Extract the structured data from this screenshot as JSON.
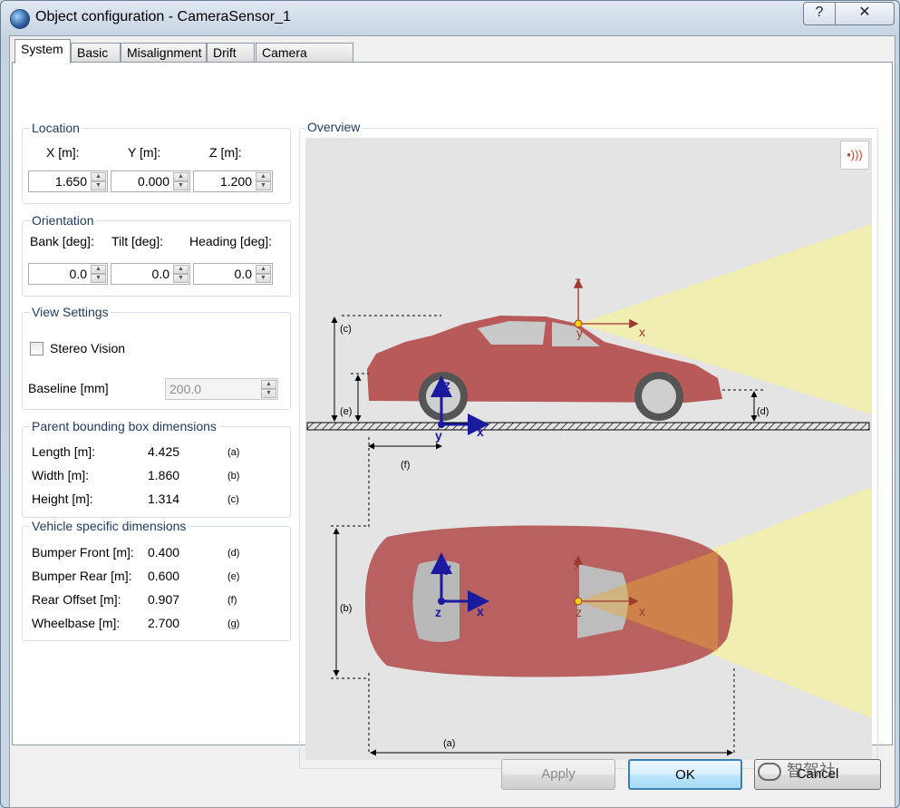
{
  "window": {
    "title": "Object configuration - CameraSensor_1",
    "help_glyph": "?",
    "close_glyph": "✕"
  },
  "tabs": [
    {
      "label": "System"
    },
    {
      "label": "Basic"
    },
    {
      "label": "Misalignment"
    },
    {
      "label": "Drift"
    },
    {
      "label": "Camera Effects"
    }
  ],
  "location": {
    "title": "Location",
    "x_label": "X  [m]:",
    "y_label": "Y [m]:",
    "z_label": "Z [m]:",
    "x_value": "1.650",
    "y_value": "0.000",
    "z_value": "1.200"
  },
  "orientation": {
    "title": "Orientation",
    "bank_label": "Bank [deg]:",
    "tilt_label": "Tilt [deg]:",
    "heading_label": "Heading [deg]:",
    "bank_value": "0.0",
    "tilt_value": "0.0",
    "heading_value": "0.0"
  },
  "view_settings": {
    "title": "View Settings",
    "stereo_label": "Stereo Vision",
    "stereo_checked": false,
    "baseline_label": "Baseline [mm]",
    "baseline_value": "200.0"
  },
  "parent_bbox": {
    "title": "Parent bounding box dimensions",
    "rows": [
      {
        "label": "Length [m]:",
        "value": "4.425",
        "unit": "(a)"
      },
      {
        "label": "Width [m]:",
        "value": "1.860",
        "unit": "(b)"
      },
      {
        "label": "Height [m]:",
        "value": "1.314",
        "unit": "(c)"
      }
    ]
  },
  "vehicle_dims": {
    "title": "Vehicle specific dimensions",
    "rows": [
      {
        "label": "Bumper Front [m]:",
        "value": "0.400",
        "unit": "(d)"
      },
      {
        "label": "Bumper Rear [m]:",
        "value": "0.600",
        "unit": "(e)"
      },
      {
        "label": "Rear Offset [m]:",
        "value": "0.907",
        "unit": "(f)"
      },
      {
        "label": "Wheelbase [m]:",
        "value": "2.700",
        "unit": "(g)"
      }
    ]
  },
  "overview": {
    "title": "Overview",
    "dim_labels": {
      "a": "(a)",
      "b": "(b)",
      "c": "(c)",
      "d": "(d)",
      "e": "(e)",
      "f": "(f)"
    },
    "axes": {
      "x": "x",
      "y": "y",
      "z": "z"
    },
    "colors": {
      "car": "#b24a4a",
      "fov": "#f2f0a8",
      "vehicle_axes": "#1a1a9e",
      "sensor_axes": "#a0382d",
      "sensor_point": "#f5d000"
    }
  },
  "buttons": {
    "apply": "Apply",
    "ok": "OK",
    "cancel": "Cancel"
  },
  "watermark": {
    "text": "智驾社"
  }
}
